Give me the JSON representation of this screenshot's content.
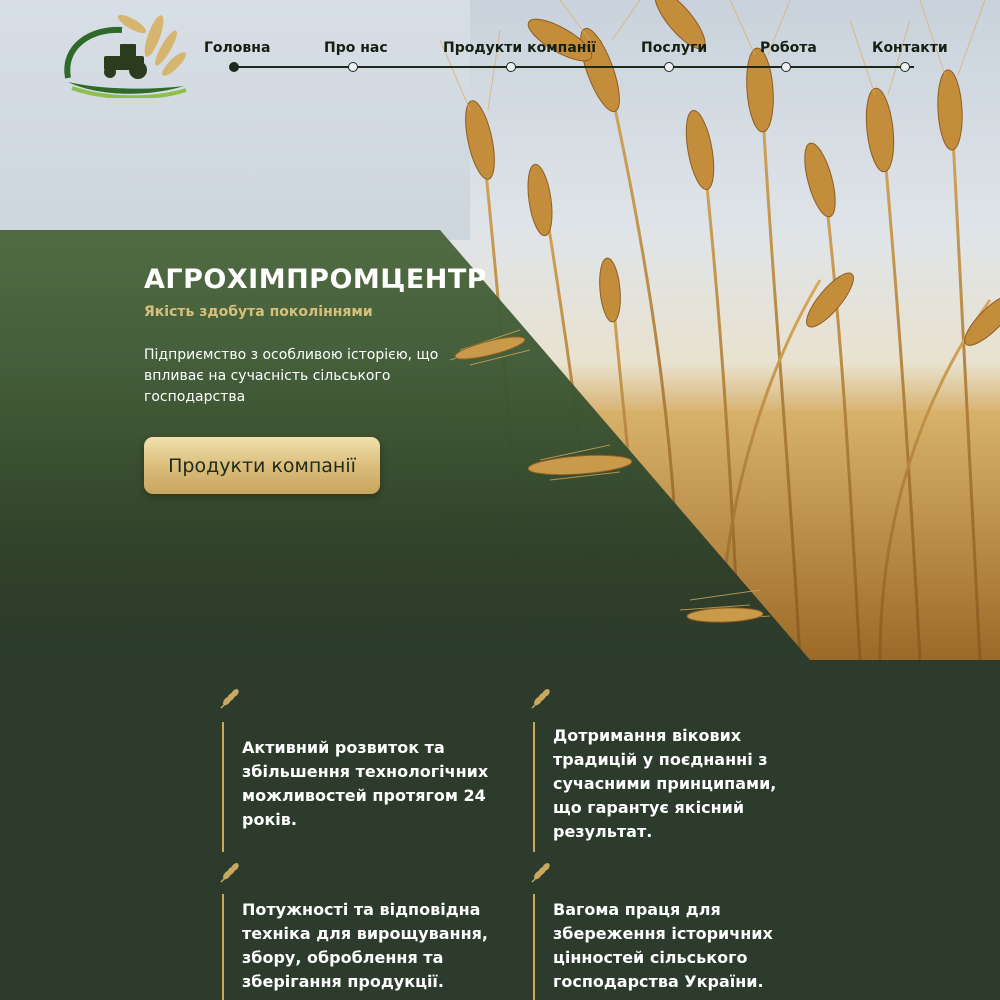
{
  "brand": {
    "logo_name": "agro-logo",
    "title": "АГРОХІМПРОМЦЕНТР",
    "subtitle": "Якість здобута поколіннями",
    "description": "Підприємство з особливою історією, що впливає на сучасність сільського господарства"
  },
  "nav": {
    "items": [
      {
        "label": "Головна",
        "active": true
      },
      {
        "label": "Про нас",
        "active": false
      },
      {
        "label": "Продукти компанії",
        "active": false
      },
      {
        "label": "Послуги",
        "active": false
      },
      {
        "label": "Робота",
        "active": false
      },
      {
        "label": "Контакти",
        "active": false
      }
    ]
  },
  "cta": {
    "label": "Продукти компанії"
  },
  "features": [
    {
      "icon": "wheat-icon",
      "text": "Активний розвиток та збільшення технологічних можливостей протягом 24 років."
    },
    {
      "icon": "wheat-icon",
      "text": "Дотримання вікових традицій у поєднанні з сучасними принципами, що гарантує якісний результат."
    },
    {
      "icon": "wheat-icon",
      "text": "Потужності та відповідна техніка для вирощування, збору, оброблення та зберігання продукції."
    },
    {
      "icon": "wheat-icon",
      "text": "Вагома праця для збереження історичних цінностей сільського господарства України."
    }
  ],
  "colors": {
    "panel_green": "#3a5432",
    "dark_green": "#2c3b2b",
    "gold_accent": "#d6c07c",
    "button_gold": "#d9bb78"
  }
}
